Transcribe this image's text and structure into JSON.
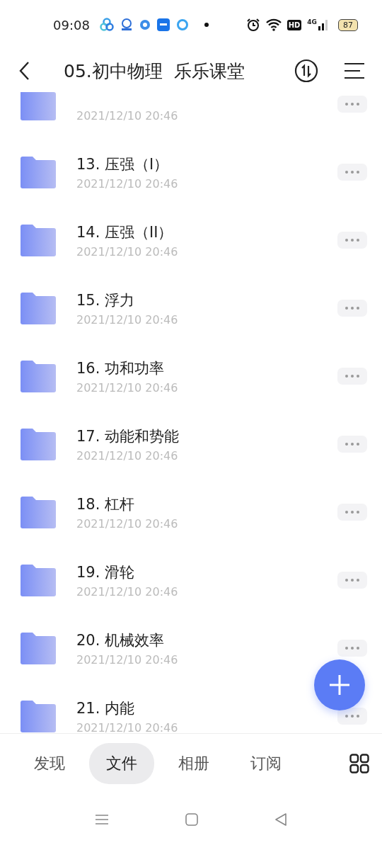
{
  "status_bar": {
    "time": "09:08",
    "hd": "HD",
    "network": "4G",
    "battery": "87"
  },
  "header": {
    "title": "05.初中物理  乐乐课堂"
  },
  "files": [
    {
      "date": "2021/12/10 20:46"
    },
    {
      "name": "13. 压强（I）",
      "date": "2021/12/10 20:46"
    },
    {
      "name": "14. 压强（II）",
      "date": "2021/12/10 20:46"
    },
    {
      "name": "15. 浮力",
      "date": "2021/12/10 20:46"
    },
    {
      "name": "16. 功和功率",
      "date": "2021/12/10 20:46"
    },
    {
      "name": "17. 动能和势能",
      "date": "2021/12/10 20:46"
    },
    {
      "name": "18. 杠杆",
      "date": "2021/12/10 20:46"
    },
    {
      "name": "19. 滑轮",
      "date": "2021/12/10 20:46"
    },
    {
      "name": "20. 机械效率",
      "date": "2021/12/10 20:46"
    },
    {
      "name": "21. 内能",
      "date": "2021/12/10 20:46"
    }
  ],
  "tabs": [
    {
      "label": "发现",
      "selected": false
    },
    {
      "label": "文件",
      "selected": true
    },
    {
      "label": "相册",
      "selected": false
    },
    {
      "label": "订阅",
      "selected": false
    }
  ]
}
